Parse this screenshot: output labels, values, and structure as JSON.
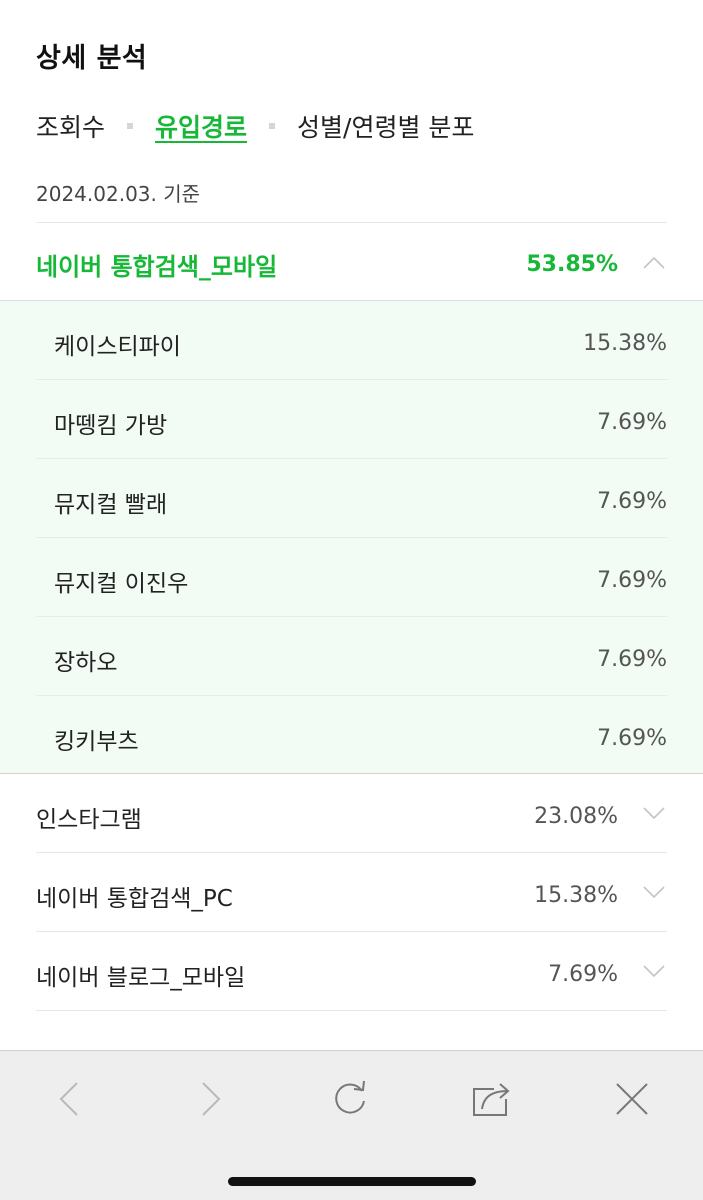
{
  "header": {
    "title": "상세 분석"
  },
  "tabs": [
    {
      "label": "조회수",
      "active": false
    },
    {
      "label": "유입경로",
      "active": true
    },
    {
      "label": "성별/연령별 분포",
      "active": false
    }
  ],
  "date_label": "2024.02.03. 기준",
  "accent_color": "#17b838",
  "expanded_source": {
    "label": "네이버 통합검색_모바일",
    "percent": "53.85%",
    "icon": "chevron-up-icon",
    "keywords": [
      {
        "label": "케이스티파이",
        "percent": "15.38%"
      },
      {
        "label": "마뗑킴 가방",
        "percent": "7.69%"
      },
      {
        "label": "뮤지컬 빨래",
        "percent": "7.69%"
      },
      {
        "label": "뮤지컬 이진우",
        "percent": "7.69%"
      },
      {
        "label": "장하오",
        "percent": "7.69%"
      },
      {
        "label": "킹키부츠",
        "percent": "7.69%"
      }
    ]
  },
  "sources": [
    {
      "label": "인스타그램",
      "percent": "23.08%",
      "icon": "chevron-down-icon"
    },
    {
      "label": "네이버 통합검색_PC",
      "percent": "15.38%",
      "icon": "chevron-down-icon"
    },
    {
      "label": "네이버 블로그_모바일",
      "percent": "7.69%",
      "icon": "chevron-down-icon"
    }
  ],
  "toolbar": {
    "buttons": [
      "back-icon",
      "forward-icon",
      "reload-icon",
      "share-icon",
      "close-icon"
    ]
  }
}
